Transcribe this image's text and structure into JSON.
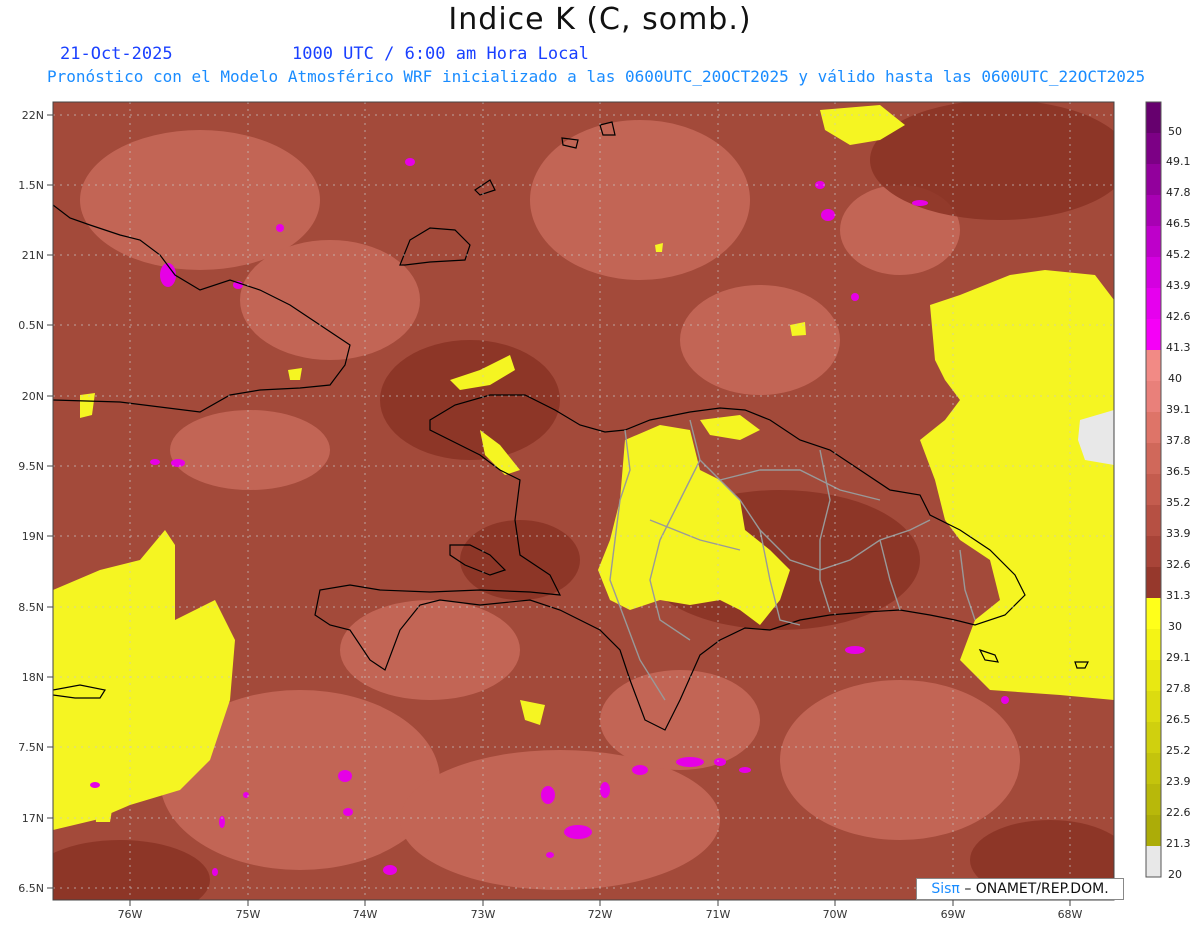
{
  "header": {
    "title": "Indice K (C, somb.)",
    "date": "21-Oct-2025",
    "time": "1000 UTC / 6:00 am Hora Local",
    "forecast": "Pronóstico con el Modelo Atmosférico WRF inicializado a las 0600UTC_20OCT2025 y válido hasta las  0600UTC_22OCT2025"
  },
  "map": {
    "lat_labels": [
      "22N",
      "1.5N",
      "21N",
      "0.5N",
      "20N",
      "9.5N",
      "19N",
      "8.5N",
      "18N",
      "7.5N",
      "17N",
      "6.5N"
    ],
    "lon_labels": [
      "76W",
      "75W",
      "74W",
      "73W",
      "72W",
      "71W",
      "70W",
      "69W",
      "68W"
    ],
    "colors": {
      "background_field": "#a34a3a",
      "dark_field": "#8a3325",
      "light_field": "#c86a5a",
      "yellow": "#f5f522",
      "magenta": "#e600e6",
      "coastline": "#000000",
      "provinces": "#999999"
    }
  },
  "colorbar": {
    "labels": [
      "50",
      "49.1",
      "47.8",
      "46.5",
      "45.2",
      "43.9",
      "42.6",
      "41.3",
      "40",
      "39.1",
      "37.8",
      "36.5",
      "35.2",
      "33.9",
      "32.6",
      "31.3",
      "30",
      "29.1",
      "27.8",
      "26.5",
      "25.2",
      "23.9",
      "22.6",
      "21.3",
      "20"
    ],
    "colors": [
      "#66006e",
      "#7c0085",
      "#92009c",
      "#a800b3",
      "#be00ca",
      "#d400e0",
      "#e600ee",
      "#f500f7",
      "#f28a85",
      "#e9807a",
      "#de7468",
      "#d0685a",
      "#c45c4e",
      "#b65043",
      "#a84438",
      "#96382c",
      "#ffff1a",
      "#f4f415",
      "#e8e812",
      "#dcdc10",
      "#d0d00e",
      "#c4c40c",
      "#b8b80a",
      "#acac08",
      "#e8e8e8"
    ]
  },
  "credit": {
    "brand": "Sisπ",
    "org": "– ONAMET/REP.DOM."
  }
}
